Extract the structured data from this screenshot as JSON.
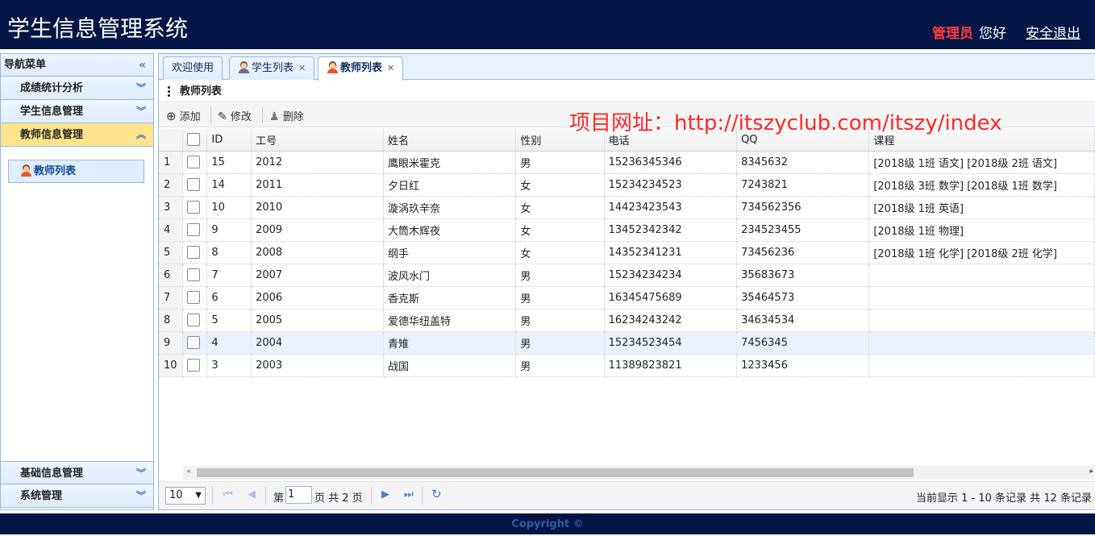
{
  "header": {
    "title": "学生信息管理系统",
    "admin": "管理员",
    "hello": "您好",
    "logout": "安全退出"
  },
  "nav": {
    "title": "导航菜单",
    "top_items": [
      "成绩统计分析",
      "学生信息管理",
      "教师信息管理"
    ],
    "selected": "教师信息管理",
    "sub_item": "教师列表",
    "bottom_items": [
      "基础信息管理",
      "系统管理"
    ]
  },
  "tabs": [
    {
      "label": "欢迎使用",
      "closable": false
    },
    {
      "label": "学生列表",
      "closable": true,
      "icon": "male-user-icon"
    },
    {
      "label": "教师列表",
      "closable": true,
      "icon": "female-user-icon",
      "active": true
    }
  ],
  "panel": {
    "title": "教师列表"
  },
  "toolbar": {
    "add": "添加",
    "edit": "修改",
    "delete": "删除"
  },
  "watermark": "项目网址：http://itszyclub.com/itszy/index",
  "table": {
    "columns": [
      "ID",
      "工号",
      "姓名",
      "性别",
      "电话",
      "QQ",
      "课程"
    ],
    "rows": [
      {
        "n": "1",
        "id": "15",
        "no": "2012",
        "name": "鹰眼米霍克",
        "sex": "男",
        "phone": "15236345346",
        "qq": "8345632",
        "course": "[2018级 1班 语文]   [2018级 2班 语文]"
      },
      {
        "n": "2",
        "id": "14",
        "no": "2011",
        "name": "夕日红",
        "sex": "女",
        "phone": "15234234523",
        "qq": "7243821",
        "course": "[2018级 3班 数学]   [2018级 1班 数学]"
      },
      {
        "n": "3",
        "id": "10",
        "no": "2010",
        "name": "漩涡玖辛奈",
        "sex": "女",
        "phone": "14423423543",
        "qq": "734562356",
        "course": "[2018级 1班 英语]"
      },
      {
        "n": "4",
        "id": "9",
        "no": "2009",
        "name": "大筒木辉夜",
        "sex": "女",
        "phone": "13452342342",
        "qq": "234523455",
        "course": "[2018级 1班 物理]"
      },
      {
        "n": "5",
        "id": "8",
        "no": "2008",
        "name": "纲手",
        "sex": "女",
        "phone": "14352341231",
        "qq": "73456236",
        "course": "[2018级 1班 化学]   [2018级 2班 化学]"
      },
      {
        "n": "6",
        "id": "7",
        "no": "2007",
        "name": "波风水门",
        "sex": "男",
        "phone": "15234234234",
        "qq": "35683673",
        "course": ""
      },
      {
        "n": "7",
        "id": "6",
        "no": "2006",
        "name": "香克斯",
        "sex": "男",
        "phone": "16345475689",
        "qq": "35464573",
        "course": ""
      },
      {
        "n": "8",
        "id": "5",
        "no": "2005",
        "name": "爱德华纽盖特",
        "sex": "男",
        "phone": "16234243242",
        "qq": "34634534",
        "course": ""
      },
      {
        "n": "9",
        "id": "4",
        "no": "2004",
        "name": "青雉",
        "sex": "男",
        "phone": "15234523454",
        "qq": "7456345",
        "course": ""
      },
      {
        "n": "10",
        "id": "3",
        "no": "2003",
        "name": "战国",
        "sex": "男",
        "phone": "11389823821",
        "qq": "1233456",
        "course": ""
      }
    ],
    "highlight_row": 9
  },
  "pager": {
    "page_size": "10",
    "page_label_pre": "第",
    "page": "1",
    "page_label_post": "页 共 2 页",
    "summary": "当前显示 1 - 10 条记录 共 12 条记录"
  },
  "footer": {
    "copyright": "Copyright ©"
  }
}
